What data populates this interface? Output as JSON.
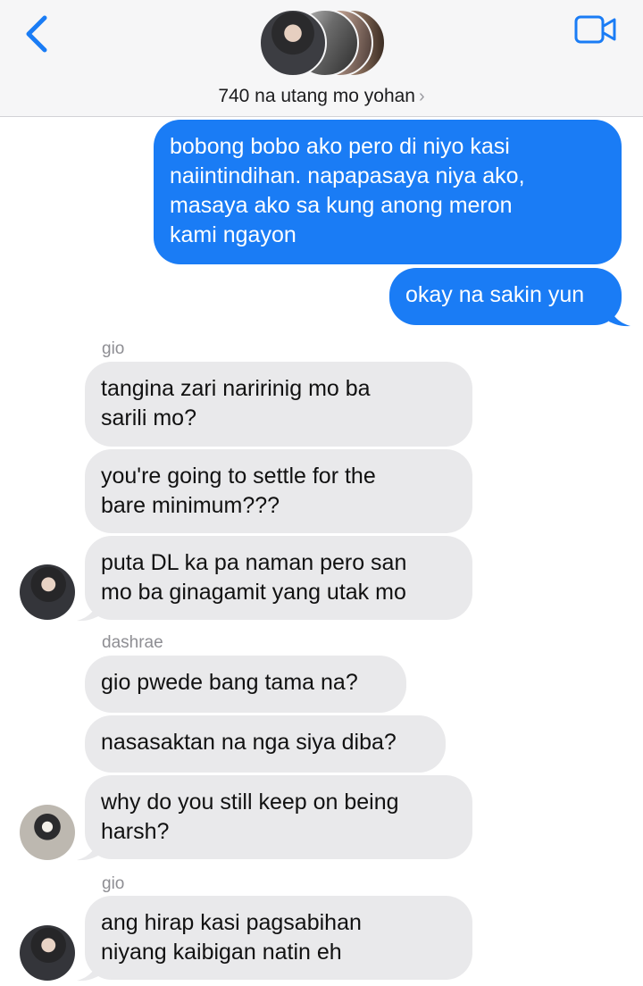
{
  "header": {
    "title": "740 na utang mo yohan",
    "colors": {
      "accent": "#1a7cf5"
    }
  },
  "messages": {
    "m1": "bobong bobo ako pero di niyo kasi\nnaiintindihan. napapasaya niya ako,\nmasaya ako sa kung anong meron\nkami ngayon",
    "m2": "okay na sakin yun",
    "sender1": "gio",
    "m3": "tangina zari naririnig mo ba\nsarili mo?",
    "m4": "you're going to settle for the\nbare minimum???",
    "m5": "puta DL ka pa naman pero san\nmo ba ginagamit yang utak mo",
    "sender2": "dashrae",
    "m6": "gio pwede bang tama na?",
    "m7": "nasasaktan na nga siya diba?",
    "m8": "why do you still keep on being\nharsh?",
    "sender3": "gio",
    "m9": "ang hirap kasi pagsabihan\nniyang kaibigan natin eh"
  }
}
